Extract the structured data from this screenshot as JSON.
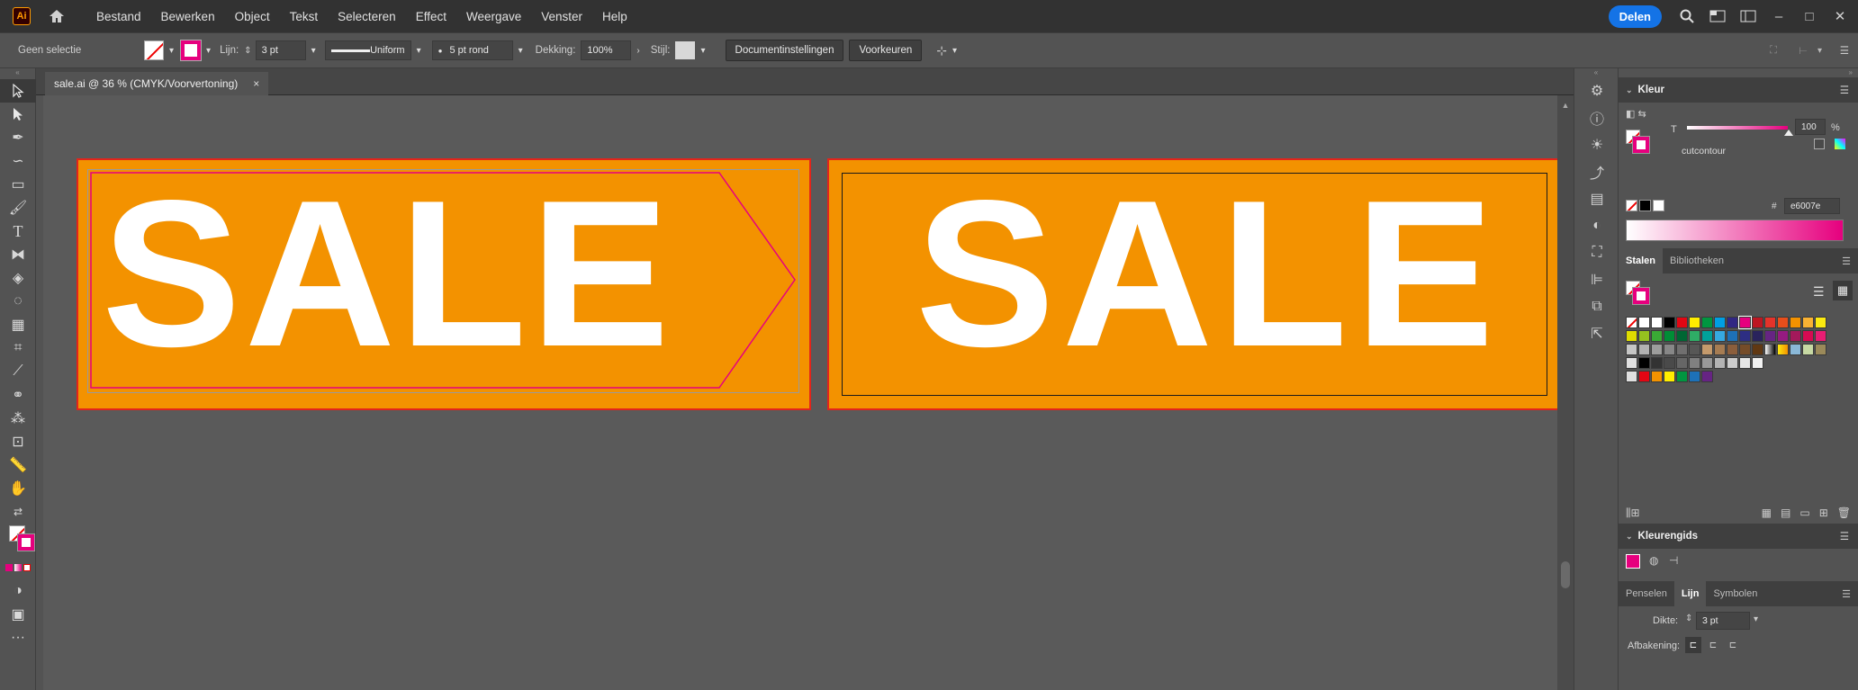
{
  "app": {
    "logo": "Ai",
    "home_icon": "home-icon"
  },
  "menu": [
    "Bestand",
    "Bewerken",
    "Object",
    "Tekst",
    "Selecteren",
    "Effect",
    "Weergave",
    "Venster",
    "Help"
  ],
  "topbar": {
    "share_label": "Delen"
  },
  "control": {
    "selection_label": "Geen selectie",
    "stroke_label": "Lijn:",
    "stroke_value": "3 pt",
    "profile_label": "Uniform",
    "brush_label": "5 pt rond",
    "opacity_label": "Dekking:",
    "opacity_value": "100%",
    "style_label": "Stijl:",
    "doc_settings": "Documentinstellingen",
    "preferences": "Voorkeuren"
  },
  "document": {
    "tab_title": "sale.ai @ 36 % (CMYK/Voorvertoning)",
    "close": "×"
  },
  "artboards": [
    {
      "text": "SALE"
    },
    {
      "text": "SALE"
    }
  ],
  "panels": {
    "color": {
      "title": "Kleur",
      "tint_label": "T",
      "tint_value": "100",
      "percent": "%",
      "swatch_name": "cutcontour",
      "hex_label": "#",
      "hex_value": "e6007e"
    },
    "swatches": {
      "tab_active": "Stalen",
      "tab_other": "Bibliotheken"
    },
    "guide": {
      "title": "Kleurengids"
    },
    "stroke": {
      "tab1": "Penselen",
      "tab2": "Lijn",
      "tab3": "Symbolen",
      "weight_label": "Dikte:",
      "weight_value": "3 pt",
      "cap_label": "Afbakening:"
    }
  },
  "colors": {
    "accent": "#e6007e",
    "artboard": "#f39200",
    "share": "#1473e6"
  }
}
